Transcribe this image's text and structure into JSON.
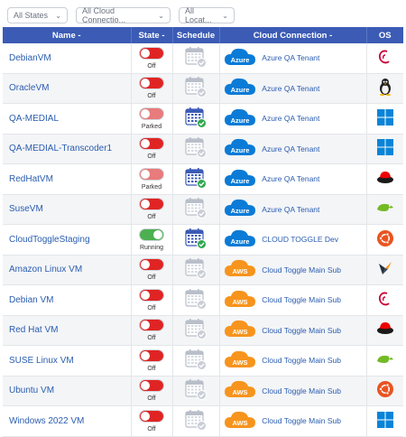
{
  "filters": [
    {
      "label": "All States"
    },
    {
      "label": "All Cloud Connectio..."
    },
    {
      "label": "All Locat..."
    }
  ],
  "columns": {
    "name": "Name -",
    "state": "State -",
    "schedule": "Schedule",
    "cloud": "Cloud Connection -",
    "os": "OS"
  },
  "colors": {
    "header": "#3b5bb5",
    "azure": "#0a7bd6",
    "aws": "#f7941d",
    "toggle_off": "#e02424",
    "toggle_on": "#4caf50",
    "link": "#2a5db0"
  },
  "rows": [
    {
      "name": "DebianVM",
      "state": "Off",
      "schedule": "inactive",
      "provider": "Azure",
      "connection": "Azure QA Tenant",
      "os": "debian-icon"
    },
    {
      "name": "OracleVM",
      "state": "Off",
      "schedule": "inactive",
      "provider": "Azure",
      "connection": "Azure QA Tenant",
      "os": "linux-tux-icon"
    },
    {
      "name": "QA-MEDIAL",
      "state": "Parked",
      "schedule": "active",
      "provider": "Azure",
      "connection": "Azure QA Tenant",
      "os": "windows-icon"
    },
    {
      "name": "QA-MEDIAL-Transcoder1",
      "state": "Off",
      "schedule": "inactive",
      "provider": "Azure",
      "connection": "Azure QA Tenant",
      "os": "windows-icon"
    },
    {
      "name": "RedHatVM",
      "state": "Parked",
      "schedule": "active",
      "provider": "Azure",
      "connection": "Azure QA Tenant",
      "os": "redhat-icon"
    },
    {
      "name": "SuseVM",
      "state": "Off",
      "schedule": "inactive",
      "provider": "Azure",
      "connection": "Azure QA Tenant",
      "os": "suse-icon"
    },
    {
      "name": "CloudToggleStaging",
      "state": "Running",
      "schedule": "active",
      "provider": "Azure",
      "connection": "CLOUD TOGGLE Dev",
      "os": "ubuntu-icon"
    },
    {
      "name": "Amazon Linux VM",
      "state": "Off",
      "schedule": "inactive",
      "provider": "AWS",
      "connection": "Cloud Toggle Main Sub",
      "os": "amazon-linux-icon"
    },
    {
      "name": "Debian VM",
      "state": "Off",
      "schedule": "inactive",
      "provider": "AWS",
      "connection": "Cloud Toggle Main Sub",
      "os": "debian-icon"
    },
    {
      "name": "Red Hat VM",
      "state": "Off",
      "schedule": "inactive",
      "provider": "AWS",
      "connection": "Cloud Toggle Main Sub",
      "os": "redhat-icon"
    },
    {
      "name": "SUSE Linux VM",
      "state": "Off",
      "schedule": "inactive",
      "provider": "AWS",
      "connection": "Cloud Toggle Main Sub",
      "os": "suse-icon"
    },
    {
      "name": "Ubuntu VM",
      "state": "Off",
      "schedule": "inactive",
      "provider": "AWS",
      "connection": "Cloud Toggle Main Sub",
      "os": "ubuntu-icon"
    },
    {
      "name": "Windows 2022 VM",
      "state": "Off",
      "schedule": "inactive",
      "provider": "AWS",
      "connection": "Cloud Toggle Main Sub",
      "os": "windows-icon"
    }
  ]
}
